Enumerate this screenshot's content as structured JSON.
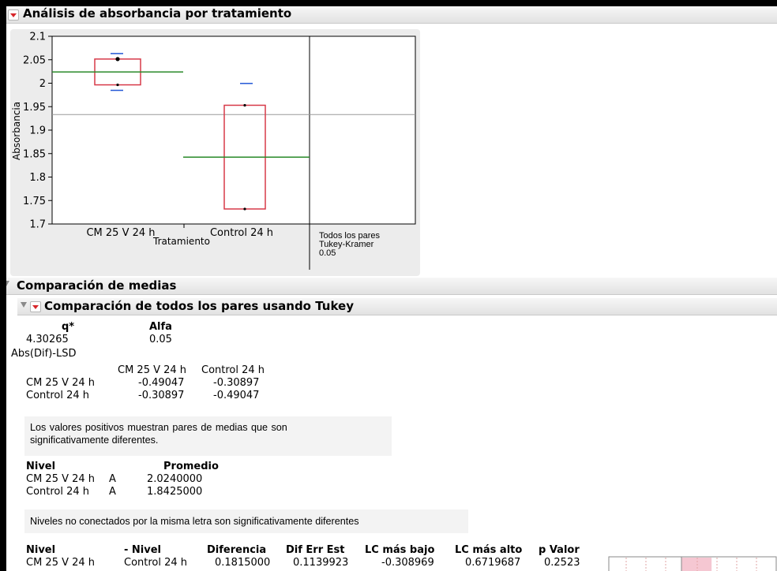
{
  "report": {
    "title": "Análisis de absorbancia por tratamiento",
    "means_section_title": "Comparación de medias",
    "tukey_section_title": "Comparación de todos los pares usando Tukey"
  },
  "chart_data": {
    "type": "box",
    "ylabel": "Absorbancia",
    "xlabel": "Tratamiento",
    "ylim": [
      1.7,
      2.1
    ],
    "yticks": [
      "2.1",
      "2.05",
      "2",
      "1.95",
      "1.9",
      "1.85",
      "1.8",
      "1.75",
      "1.7"
    ],
    "categories": [
      "CM 25 V 24 h",
      "Control 24 h"
    ],
    "grand_mean": 1.93325,
    "groups": [
      {
        "name": "CM 25 V 24 h",
        "box_low": 1.9965,
        "box_high": 2.0515,
        "points": [
          2.0515,
          1.9965
        ],
        "mean": 2.024,
        "ci_high": 2.0632,
        "ci_low": 1.9848
      },
      {
        "name": "Control 24 h",
        "box_low": 1.732,
        "box_high": 1.953,
        "points": [
          1.953,
          1.732
        ],
        "mean": 1.8425,
        "ci_high": 1.9995,
        "ci_low": null
      }
    ],
    "comparison_circles_label": [
      "Todos los pares",
      "Tukey-Kramer",
      "0.05"
    ],
    "colors": {
      "box": "#d73a49",
      "mean": "#2a8a2a",
      "ci": "#2257d6",
      "grand_mean": "#9a9a9a"
    }
  },
  "tukey": {
    "q_header": "q*",
    "alpha_header": "Alfa",
    "q_value": "4.30265",
    "alpha_value": "0.05",
    "lsd_title": "Abs(Dif)-LSD",
    "lsd_cols": [
      "CM 25 V 24 h",
      "Control 24 h"
    ],
    "lsd_rows": [
      {
        "label": "CM 25 V 24 h",
        "values": [
          "-0.49047",
          "-0.30897"
        ]
      },
      {
        "label": "Control 24 h",
        "values": [
          "-0.30897",
          "-0.49047"
        ]
      }
    ],
    "positive_note_line1": "Los valores positivos muestran pares de medias que son",
    "positive_note_line2": "significativamente diferentes.",
    "letters_headers": [
      "Nivel",
      "Promedio"
    ],
    "letters_rows": [
      {
        "level": "CM 25 V 24 h",
        "letter": "A",
        "mean": "2.0240000"
      },
      {
        "level": "Control 24 h",
        "letter": "A",
        "mean": "1.8425000"
      }
    ],
    "letters_note": "Niveles no conectados por la misma letra son significativamente diferentes",
    "diff_headers": [
      "Nivel",
      "- Nivel",
      "Diferencia",
      "Dif Err Est",
      "LC más bajo",
      "LC más alto",
      "p Valor"
    ],
    "diff_row": {
      "level": "CM 25 V 24 h",
      "minus_level": "Control 24 h",
      "diff": "0.1815000",
      "std_err": "0.1139923",
      "lower_cl": "-0.308969",
      "upper_cl": "0.6719687",
      "p_value": "0.2523",
      "diff_bar_fraction": 0.18
    }
  }
}
